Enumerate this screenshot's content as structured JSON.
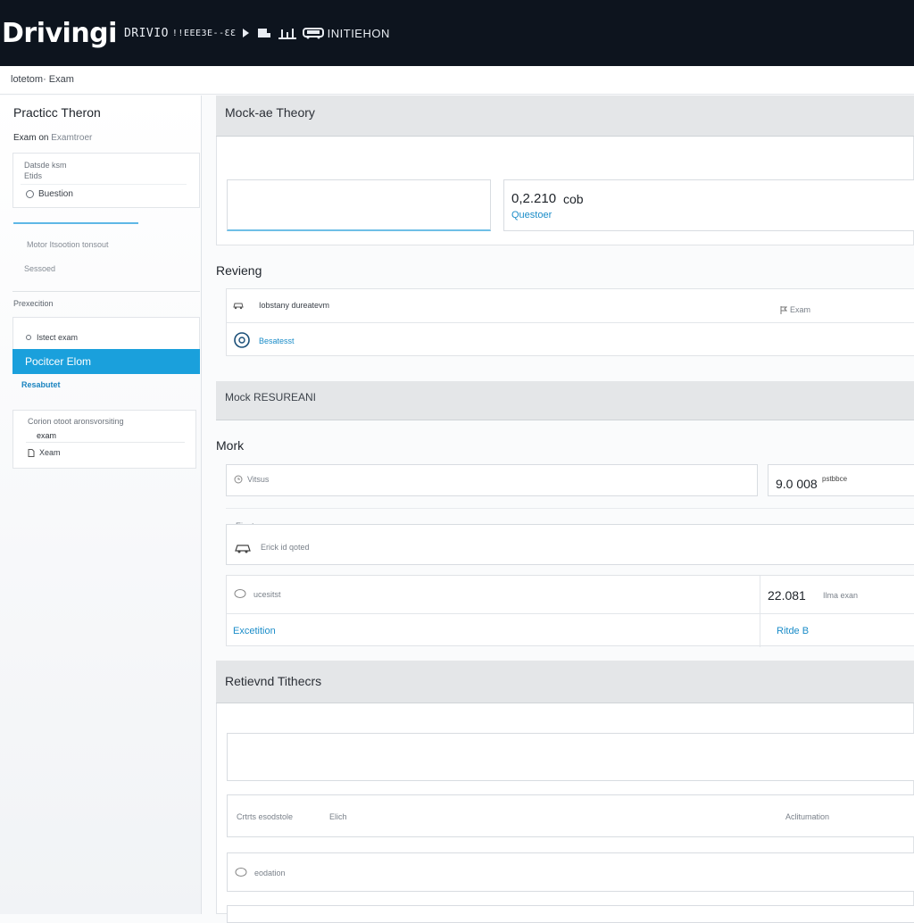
{
  "header": {
    "brand": "Drivingi",
    "brand_sub": "DRIVIO",
    "brand_mid": "!!EEE3E--ƐƐ",
    "brand_right": "INITIEHON"
  },
  "breadcrumb": "lotetom· Exam",
  "sidebar": {
    "title": "Practicc Theron",
    "subtitle_bold": "Exam on",
    "subtitle_muted": "Examtroer",
    "card1_line1": "Datsde ksm",
    "card1_line2": "Etids",
    "card1_item": "Buestion",
    "item_1": "Motor Itsootion tonsout",
    "item_2": "Sessoed",
    "section_label": "Prexecition",
    "card2_item": "Istect exam",
    "active_item": "Pocitcer Elom",
    "link": "Resabutet",
    "card3_line1": "Corion otoot aronsvorsiting",
    "card3_line2": "exam",
    "card3_line3": "Xeam"
  },
  "main": {
    "bar1_title": "Mock-ae Theory",
    "stat1_value": "0,2.210",
    "stat1_unit": "cob",
    "stat1_label": "Questoer",
    "section_review": "Revieng",
    "review_row1_text": "Iobstany dureatevm",
    "review_row1_right": "Exam",
    "review_row2_link": "Besatesst",
    "bar2_title": "Mock RESUREANI",
    "section_mark": "Mork",
    "mark_field1_text": "Vitsus",
    "mark_value1": "9.0 008",
    "mark_value1_small": "pstbbce",
    "mark_small_label": "Eiont",
    "mark_field2_text": "Erick id qoted",
    "mark_field3_text": "ucesitst",
    "mark_value2": "22.081",
    "mark_value2_small": "Ilma exan",
    "mark_link1": "Excetition",
    "mark_link2": "Ritde B",
    "bar3_title": "Retievnd Tithecrs",
    "bottom_row1_text": "Crtrts  esodstole",
    "bottom_row1_mid": "Elich",
    "bottom_row1_right": "Aclitumation",
    "bottom_row2_text": "eodation"
  },
  "colors": {
    "header_bg": "#0d141e",
    "accent": "#1aa0dc",
    "link": "#1a8cc8"
  }
}
